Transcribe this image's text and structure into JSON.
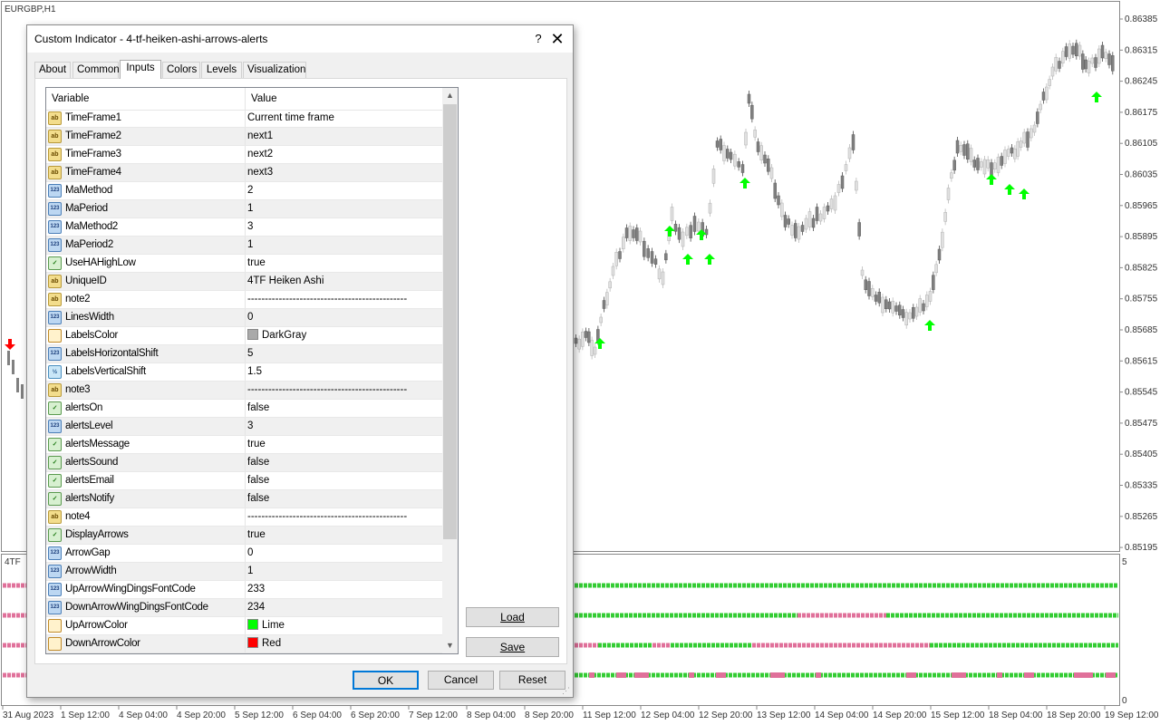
{
  "chart": {
    "symbol_label": "EURGBP,H1",
    "indicator_label": "4TF",
    "price_ticks": [
      "0.86385",
      "0.86315",
      "0.86245",
      "0.86175",
      "0.86105",
      "0.86035",
      "0.85965",
      "0.85895",
      "0.85825",
      "0.85755",
      "0.85685",
      "0.85615",
      "0.85545",
      "0.85475",
      "0.85405",
      "0.85335",
      "0.85265",
      "0.85195"
    ],
    "indicator_ticks": [
      "5",
      "0"
    ],
    "time_ticks": [
      "31 Aug 2023",
      "1 Sep 12:00",
      "4 Sep 04:00",
      "4 Sep 20:00",
      "5 Sep 12:00",
      "6 Sep 04:00",
      "6 Sep 20:00",
      "7 Sep 12:00",
      "8 Sep 04:00",
      "8 Sep 20:00",
      "11 Sep 12:00",
      "12 Sep 04:00",
      "12 Sep 20:00",
      "13 Sep 12:00",
      "14 Sep 04:00",
      "14 Sep 20:00",
      "15 Sep 12:00",
      "18 Sep 04:00",
      "18 Sep 20:00",
      "19 Sep 12:00"
    ],
    "colors": {
      "up_arrow": "#00ff00",
      "down_arrow": "#ff0000",
      "bull": "#e0e0e0",
      "bear": "#808080",
      "line_green": "#33cc33",
      "line_pink": "#e0709a"
    }
  },
  "dialog": {
    "title": "Custom Indicator - 4-tf-heiken-ashi-arrows-alerts",
    "help": "?",
    "close": "✕",
    "tabs": [
      "About",
      "Common",
      "Inputs",
      "Colors",
      "Levels",
      "Visualization"
    ],
    "active_tab": "Inputs",
    "grid": {
      "headers": {
        "variable": "Variable",
        "value": "Value"
      },
      "rows": [
        {
          "type": "string",
          "icon": "ab",
          "name": "TimeFrame1",
          "value": "Current time frame"
        },
        {
          "type": "string",
          "icon": "ab",
          "name": "TimeFrame2",
          "value": "next1"
        },
        {
          "type": "string",
          "icon": "ab",
          "name": "TimeFrame3",
          "value": "next2"
        },
        {
          "type": "string",
          "icon": "ab",
          "name": "TimeFrame4",
          "value": "next3"
        },
        {
          "type": "int",
          "icon": "123",
          "name": "MaMethod",
          "value": "2"
        },
        {
          "type": "int",
          "icon": "123",
          "name": "MaPeriod",
          "value": "1"
        },
        {
          "type": "int",
          "icon": "123",
          "name": "MaMethod2",
          "value": "3"
        },
        {
          "type": "int",
          "icon": "123",
          "name": "MaPeriod2",
          "value": "1"
        },
        {
          "type": "bool",
          "icon": "✓",
          "name": "UseHAHighLow",
          "value": "true"
        },
        {
          "type": "string",
          "icon": "ab",
          "name": "UniqueID",
          "value": "4TF Heiken Ashi"
        },
        {
          "type": "string",
          "icon": "ab",
          "name": "note2",
          "value": "----------------------------------------------"
        },
        {
          "type": "int",
          "icon": "123",
          "name": "LinesWidth",
          "value": "0"
        },
        {
          "type": "color",
          "icon": "",
          "name": "LabelsColor",
          "value": "DarkGray",
          "swatch": "#a9a9a9"
        },
        {
          "type": "int",
          "icon": "123",
          "name": "LabelsHorizontalShift",
          "value": "5"
        },
        {
          "type": "double",
          "icon": "½",
          "name": "LabelsVerticalShift",
          "value": "1.5"
        },
        {
          "type": "string",
          "icon": "ab",
          "name": "note3",
          "value": "----------------------------------------------"
        },
        {
          "type": "bool",
          "icon": "✓",
          "name": "alertsOn",
          "value": "false"
        },
        {
          "type": "int",
          "icon": "123",
          "name": "alertsLevel",
          "value": "3"
        },
        {
          "type": "bool",
          "icon": "✓",
          "name": "alertsMessage",
          "value": "true"
        },
        {
          "type": "bool",
          "icon": "✓",
          "name": "alertsSound",
          "value": "false"
        },
        {
          "type": "bool",
          "icon": "✓",
          "name": "alertsEmail",
          "value": "false"
        },
        {
          "type": "bool",
          "icon": "✓",
          "name": "alertsNotify",
          "value": "false"
        },
        {
          "type": "string",
          "icon": "ab",
          "name": "note4",
          "value": "----------------------------------------------"
        },
        {
          "type": "bool",
          "icon": "✓",
          "name": "DisplayArrows",
          "value": "true"
        },
        {
          "type": "int",
          "icon": "123",
          "name": "ArrowGap",
          "value": "0"
        },
        {
          "type": "int",
          "icon": "123",
          "name": "ArrowWidth",
          "value": "1"
        },
        {
          "type": "int",
          "icon": "123",
          "name": "UpArrowWingDingsFontCode",
          "value": "233"
        },
        {
          "type": "int",
          "icon": "123",
          "name": "DownArrowWingDingsFontCode",
          "value": "234"
        },
        {
          "type": "color",
          "icon": "",
          "name": "UpArrowColor",
          "value": "Lime",
          "swatch": "#00ff00"
        },
        {
          "type": "color",
          "icon": "",
          "name": "DownArrowColor",
          "value": "Red",
          "swatch": "#ff0000"
        }
      ]
    },
    "buttons": {
      "load": "Load",
      "save": "Save",
      "ok": "OK",
      "cancel": "Cancel",
      "reset": "Reset"
    },
    "scroll": {
      "up": "▲",
      "down": "▼"
    }
  }
}
